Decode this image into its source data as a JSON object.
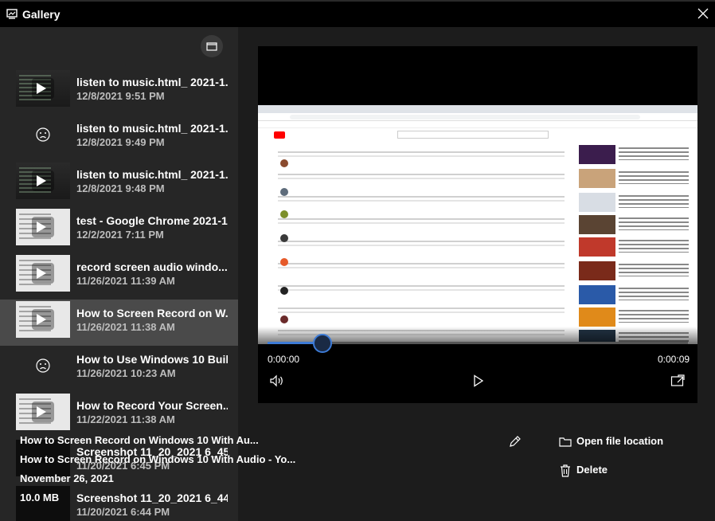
{
  "window": {
    "title": "Gallery"
  },
  "sidebar": {
    "items": [
      {
        "name": "listen to music.html_ 2021-1...",
        "date": "12/8/2021 9:51 PM",
        "thumb": "code",
        "status": "play"
      },
      {
        "name": "listen to music.html_ 2021-1...",
        "date": "12/8/2021 9:49 PM",
        "thumb": "blank",
        "status": "sad-face"
      },
      {
        "name": "listen to music.html_ 2021-1...",
        "date": "12/8/2021 9:48 PM",
        "thumb": "code",
        "status": "play"
      },
      {
        "name": "test - Google Chrome 2021-1...",
        "date": "12/2/2021 7:11 PM",
        "thumb": "light",
        "status": "play"
      },
      {
        "name": "record screen audio windo...",
        "date": "11/26/2021 11:39 AM",
        "thumb": "light",
        "status": "play"
      },
      {
        "name": "How to Screen Record on W...",
        "date": "11/26/2021 11:38 AM",
        "thumb": "light",
        "status": "play",
        "selected": true
      },
      {
        "name": "How to Use Windows 10 Buil...",
        "date": "11/26/2021 10:23 AM",
        "thumb": "blank",
        "status": "sad-face"
      },
      {
        "name": "How to Record Your Screen...",
        "date": "11/22/2021 11:38 AM",
        "thumb": "light",
        "status": "play"
      },
      {
        "name": "Screenshot 11_20_2021 6_45...",
        "date": "11/20/2021 6:45 PM",
        "thumb": "dark",
        "status": "none"
      },
      {
        "name": "Screenshot 11_20_2021 6_44...",
        "date": "11/20/2021 6:44 PM",
        "thumb": "dark",
        "status": "none"
      }
    ]
  },
  "player": {
    "current_time": "0:00:00",
    "duration": "0:00:09",
    "progress_fraction": 0.13,
    "accent_color": "#3d7bd6"
  },
  "details": {
    "title": "How to Screen Record on Windows 10 With Au...",
    "source": "How to Screen Record on Windows 10 With Audio - Yo...",
    "date": "November 26, 2021",
    "size": "10.0 MB"
  },
  "actions": {
    "open_location": "Open file location",
    "delete": "Delete"
  },
  "icons": {
    "app": "gallery-icon",
    "close": "close-icon",
    "folder": "folder-icon",
    "edit": "pencil-icon",
    "volume": "volume-icon",
    "play": "play-icon",
    "miniplayer": "miniplayer-icon",
    "trash": "trash-icon"
  }
}
